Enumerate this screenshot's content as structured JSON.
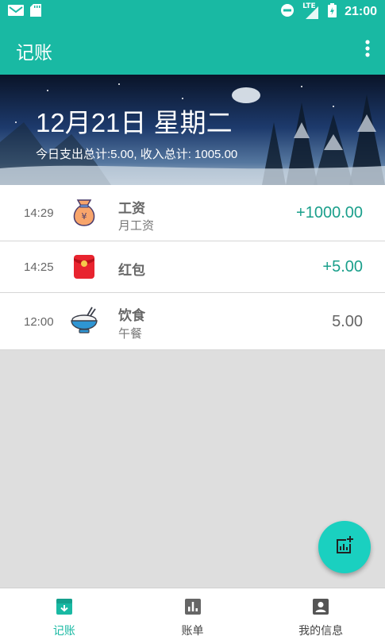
{
  "status_bar": {
    "time": "21:00",
    "network": "LTE"
  },
  "app_bar": {
    "title": "记账"
  },
  "header": {
    "date": "12月21日 星期二",
    "summary": "今日支出总计:5.00, 收入总计: 1005.00"
  },
  "records": [
    {
      "time": "14:29",
      "category": "工资",
      "note": "月工资",
      "amount": "+1000.00",
      "type": "income",
      "icon": "money-bag-icon"
    },
    {
      "time": "14:25",
      "category": "红包",
      "note": "",
      "amount": "+5.00",
      "type": "income",
      "icon": "red-envelope-icon"
    },
    {
      "time": "12:00",
      "category": "饮食",
      "note": "午餐",
      "amount": "5.00",
      "type": "expense",
      "icon": "rice-bowl-icon"
    }
  ],
  "fab": {
    "icon": "add-chart-icon"
  },
  "bottom_nav": [
    {
      "label": "记账",
      "icon": "bookkeeping-icon",
      "active": true
    },
    {
      "label": "账单",
      "icon": "bar-chart-icon",
      "active": false
    },
    {
      "label": "我的信息",
      "icon": "account-icon",
      "active": false
    }
  ],
  "colors": {
    "primary": "#19b9a3",
    "fab": "#1ad0c0",
    "income": "#1a9f8b",
    "expense": "#666666"
  }
}
